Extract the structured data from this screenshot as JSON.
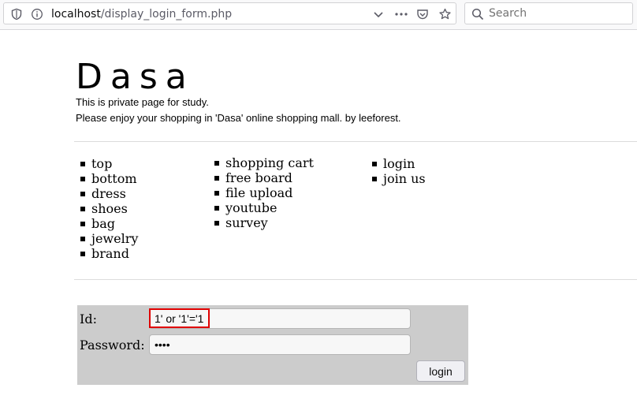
{
  "browser": {
    "url_host": "localhost",
    "url_path": "/display_login_form.php",
    "search_placeholder": "Search"
  },
  "site": {
    "title": "Dasa",
    "tagline_1": "This is private page for study.",
    "tagline_2": "Please enjoy your shopping in 'Dasa' online shopping mall. by leeforest."
  },
  "menu": {
    "col1": [
      "top",
      "bottom",
      "dress",
      "shoes",
      "bag",
      "jewelry",
      "brand"
    ],
    "col2": [
      "shopping cart",
      "free board",
      "file upload",
      "youtube",
      "survey"
    ],
    "col3": [
      "login",
      "join us"
    ]
  },
  "login_form": {
    "id_label": "Id:",
    "id_value": "1' or '1'='1",
    "password_label": "Password:",
    "password_value": "1234",
    "submit_label": "login",
    "highlight_color": "#e00000",
    "background_color": "#cccccc"
  }
}
